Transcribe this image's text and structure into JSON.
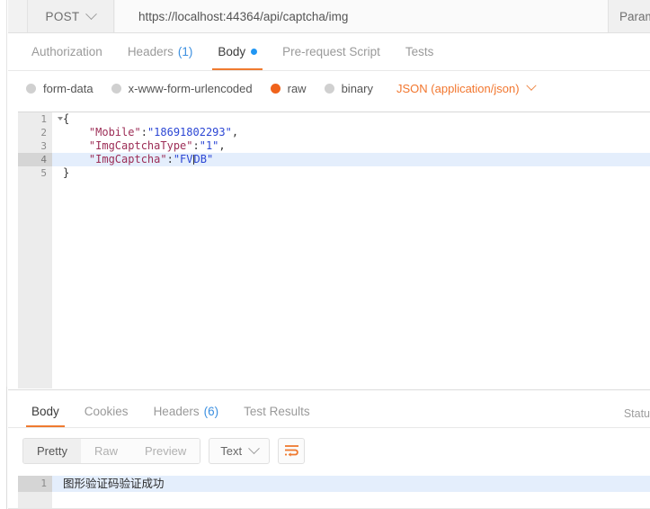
{
  "request_bar": {
    "method": "POST",
    "method_caret_icon": "chevron-down-icon",
    "url": "https://localhost:44364/api/captcha/img",
    "params_label": "Param"
  },
  "request_tabs": [
    {
      "label": "Authorization",
      "active": false
    },
    {
      "label": "Headers",
      "count": "(1)",
      "active": false
    },
    {
      "label": "Body",
      "active": true,
      "indicator": "blue-dot"
    },
    {
      "label": "Pre-request Script",
      "active": false
    },
    {
      "label": "Tests",
      "active": false
    }
  ],
  "body_type": {
    "options": [
      {
        "label": "form-data",
        "selected": false
      },
      {
        "label": "x-www-form-urlencoded",
        "selected": false
      },
      {
        "label": "raw",
        "selected": true
      },
      {
        "label": "binary",
        "selected": false
      }
    ],
    "content_type": "JSON (application/json)",
    "content_type_caret_icon": "chevron-down-icon",
    "selected_color": "#f0631b",
    "content_type_color": "#f2762e"
  },
  "request_editor": {
    "lines": [
      {
        "num": "1",
        "fold": true,
        "active": false,
        "tokens": [
          {
            "t": "{",
            "c": "p"
          }
        ]
      },
      {
        "num": "2",
        "fold": false,
        "active": false,
        "tokens": [
          {
            "t": "    \"Mobile\"",
            "c": "k"
          },
          {
            "t": ":",
            "c": "p"
          },
          {
            "t": "\"18691802293\"",
            "c": "v"
          },
          {
            "t": ",",
            "c": "p"
          }
        ]
      },
      {
        "num": "3",
        "fold": false,
        "active": false,
        "tokens": [
          {
            "t": "    \"ImgCaptchaType\"",
            "c": "k"
          },
          {
            "t": ":",
            "c": "p"
          },
          {
            "t": "\"1\"",
            "c": "v"
          },
          {
            "t": ",",
            "c": "p"
          }
        ]
      },
      {
        "num": "4",
        "fold": false,
        "active": true,
        "tokens": [
          {
            "t": "    \"ImgCaptcha\"",
            "c": "k"
          },
          {
            "t": ":",
            "c": "p"
          },
          {
            "t": "\"FV",
            "c": "v"
          },
          {
            "t": "|",
            "c": "cursor"
          },
          {
            "t": "DB\"",
            "c": "v"
          }
        ]
      },
      {
        "num": "5",
        "fold": false,
        "active": false,
        "tokens": [
          {
            "t": "}",
            "c": "p"
          }
        ]
      }
    ],
    "key_color": "#9c2d56",
    "value_color": "#2b46d4",
    "active_line_color": "#e4eefc"
  },
  "response_tabs": [
    {
      "label": "Body",
      "active": true
    },
    {
      "label": "Cookies",
      "active": false
    },
    {
      "label": "Headers",
      "count": "(6)",
      "active": false
    },
    {
      "label": "Test Results",
      "active": false
    }
  ],
  "response_status_label": "Statu",
  "response_toolbar": {
    "view_modes": [
      {
        "label": "Pretty",
        "active": true
      },
      {
        "label": "Raw",
        "active": false
      },
      {
        "label": "Preview",
        "active": false
      }
    ],
    "format": "Text",
    "format_caret_icon": "chevron-down-icon",
    "wrap_icon": "word-wrap-icon",
    "wrap_icon_color": "#ef7a30"
  },
  "response_body": {
    "line_number": "1",
    "text": "图形验证码验证成功"
  },
  "theme": {
    "accent": "#ef7a30",
    "link": "#3b8fe0"
  }
}
